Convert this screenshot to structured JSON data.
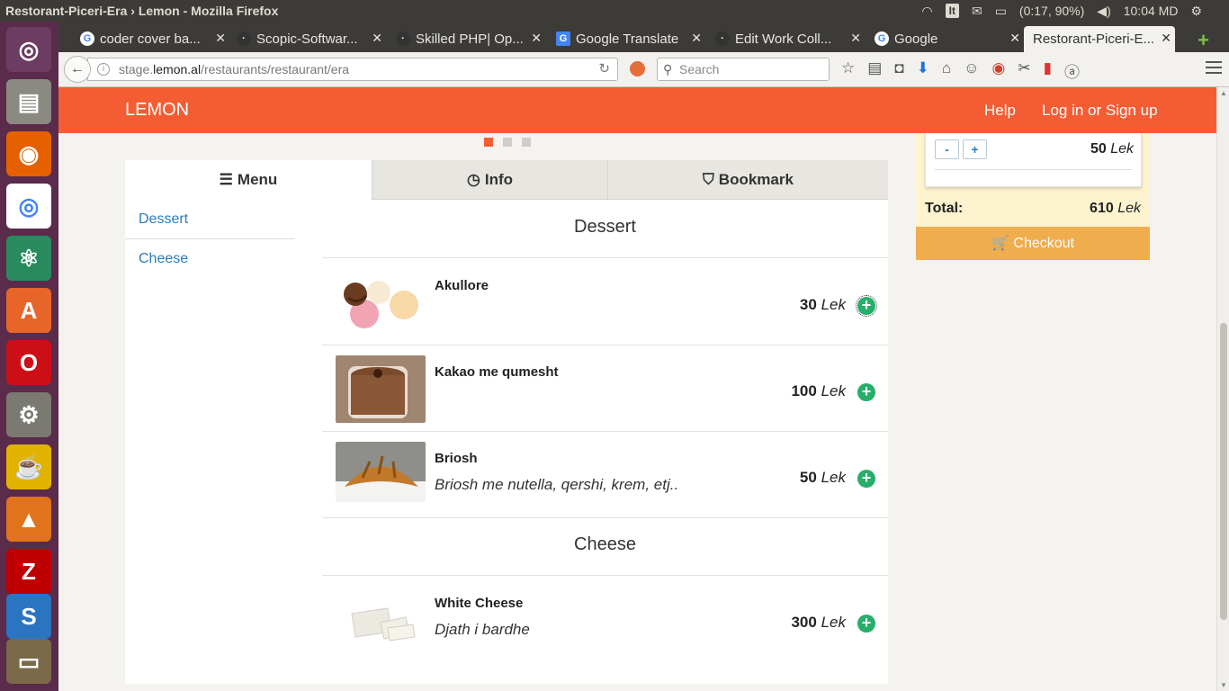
{
  "os": {
    "window_title": "Restorant-Piceri-Era › Lemon - Mozilla Firefox",
    "keyboard_layout": "It",
    "battery": "(0:17, 90%)",
    "clock": "10:04 MD"
  },
  "browser": {
    "tabs": [
      {
        "label": "coder cover ba...",
        "icon": "google-icon"
      },
      {
        "label": "Scopic-Softwar...",
        "icon": "site-icon"
      },
      {
        "label": "Skilled PHP| Op...",
        "icon": "site-icon"
      },
      {
        "label": "Google Translate",
        "icon": "translate-icon"
      },
      {
        "label": "Edit Work Coll...",
        "icon": "site-icon"
      },
      {
        "label": "Google",
        "icon": "google-icon"
      },
      {
        "label": "Restorant-Piceri-E...",
        "icon": "none"
      }
    ],
    "url_prefix": "stage.",
    "url_domain": "lemon.al",
    "url_path": "/restaurants/restaurant/era",
    "search_placeholder": "Search"
  },
  "site": {
    "brand": "LEMON",
    "help": "Help",
    "login": "Log in or Sign up",
    "colors": {
      "brand": "#f45d34",
      "add": "#27ae6a",
      "checkout": "#f0ad4e",
      "link": "#2a7db8"
    }
  },
  "tabs": {
    "menu": "Menu",
    "info": "Info",
    "bookmark": "Bookmark"
  },
  "categories": [
    "Dessert",
    "Cheese"
  ],
  "sections": {
    "dessert": {
      "title": "Dessert",
      "items": [
        {
          "name": "Akullore",
          "desc": "",
          "price": "30",
          "currency": "Lek"
        },
        {
          "name": "Kakao me qumesht",
          "desc": "",
          "price": "100",
          "currency": "Lek"
        },
        {
          "name": "Briosh",
          "desc": "Briosh me nutella, qershi, krem, etj..",
          "price": "50",
          "currency": "Lek"
        }
      ]
    },
    "cheese": {
      "title": "Cheese",
      "items": [
        {
          "name": "White Cheese",
          "desc": "Djath i bardhe",
          "price": "300",
          "currency": "Lek"
        }
      ]
    }
  },
  "cart": {
    "minus": "-",
    "plus": "+",
    "item_price": "50",
    "currency": "Lek",
    "total_label": "Total:",
    "total_value": "610",
    "checkout": "Checkout"
  }
}
